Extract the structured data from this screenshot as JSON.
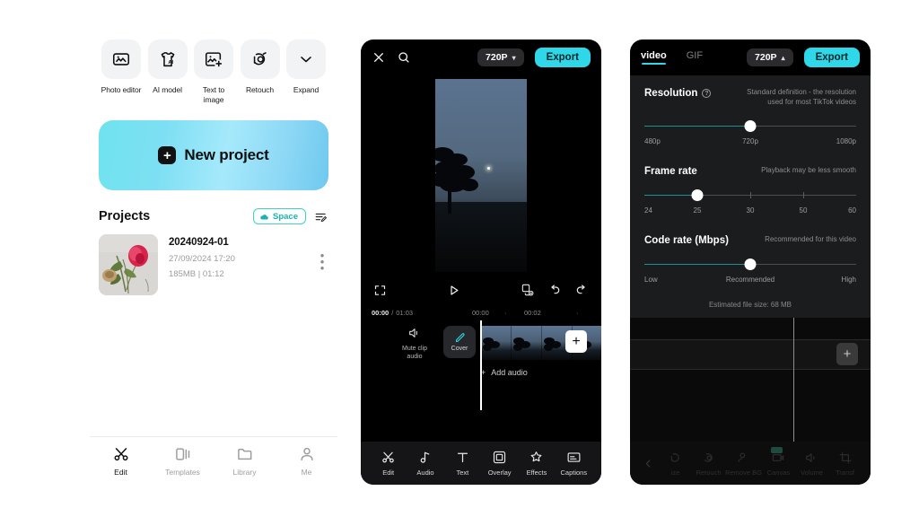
{
  "home": {
    "tools": [
      {
        "label": "Photo editor",
        "icon": "photo-editor-icon"
      },
      {
        "label": "AI model",
        "icon": "ai-model-icon"
      },
      {
        "label": "Text to image",
        "icon": "text-to-image-icon"
      },
      {
        "label": "Retouch",
        "icon": "retouch-icon"
      },
      {
        "label": "Expand",
        "icon": "chevron-down-icon"
      }
    ],
    "new_project_label": "New project",
    "projects_title": "Projects",
    "space_label": "Space",
    "project": {
      "name": "20240924-01",
      "date": "27/09/2024 17:20",
      "size": "185MB",
      "separator": "|",
      "duration": "01:12"
    },
    "nav": [
      {
        "label": "Edit",
        "icon": "scissors-icon",
        "active": true
      },
      {
        "label": "Templates",
        "icon": "templates-icon",
        "active": false
      },
      {
        "label": "Library",
        "icon": "folder-icon",
        "active": false
      },
      {
        "label": "Me",
        "icon": "person-icon",
        "active": false
      }
    ]
  },
  "editor": {
    "close_icon": "close-icon",
    "search_icon": "search-icon",
    "resolution_chip": "720P",
    "chip_caret": "▾",
    "export_label": "Export",
    "timeline": {
      "current": "00:00",
      "divider": "/",
      "total": "01:03",
      "marks": [
        "00:00",
        "00:02"
      ]
    },
    "mute_label": "Mute clip audio",
    "cover_label": "Cover",
    "add_audio_label": "Add audio",
    "add_audio_plus": "+",
    "clip_plus": "+",
    "toolbar": [
      {
        "label": "Edit",
        "icon": "scissors-icon"
      },
      {
        "label": "Audio",
        "icon": "music-note-icon"
      },
      {
        "label": "Text",
        "icon": "text-icon"
      },
      {
        "label": "Overlay",
        "icon": "overlay-icon"
      },
      {
        "label": "Effects",
        "icon": "effects-icon"
      },
      {
        "label": "Captions",
        "icon": "captions-icon"
      }
    ]
  },
  "export_panel": {
    "tabs": [
      {
        "label": "video",
        "active": true
      },
      {
        "label": "GIF",
        "active": false
      }
    ],
    "resolution_chip": "720P",
    "chip_caret": "▴",
    "export_label": "Export",
    "sections": [
      {
        "title": "Resolution",
        "has_help": true,
        "hint": "Standard definition - the resolution used for most TikTok videos",
        "ticks": [
          "480p",
          "720p",
          "1080p"
        ],
        "value_index": 1
      },
      {
        "title": "Frame rate",
        "has_help": false,
        "hint": "Playback may be less smooth",
        "ticks": [
          "24",
          "25",
          "30",
          "50",
          "60"
        ],
        "value_index": 1
      },
      {
        "title": "Code rate (Mbps)",
        "has_help": false,
        "hint": "Recommended for this video",
        "ticks": [
          "Low",
          "Recommended",
          "High"
        ],
        "value_index": 1
      }
    ],
    "estimated_size": "Estimated file size: 68 MB",
    "toolbar": [
      {
        "label": "ize",
        "icon": "resize-icon"
      },
      {
        "label": "Retouch",
        "icon": "retouch-icon"
      },
      {
        "label": "Remove BG",
        "icon": "remove-bg-icon"
      },
      {
        "label": "Canvas",
        "icon": "canvas-icon"
      },
      {
        "label": "Volume",
        "icon": "volume-icon"
      },
      {
        "label": "Transf",
        "icon": "transform-icon"
      }
    ],
    "back_icon": "back-chevron-icon"
  },
  "colors": {
    "accent_cyan": "#2ed8e8",
    "teal": "#19b3ad",
    "slider_fill": "#1f8f93",
    "dark_bg": "#000000",
    "panel_bg": "#1b1c1e"
  }
}
